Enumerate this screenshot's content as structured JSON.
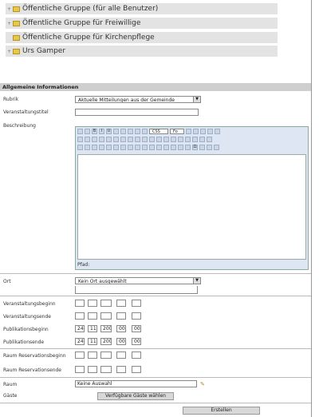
{
  "tree": {
    "items": [
      {
        "label": "Öffentliche Gruppe (für alle Benutzer)"
      },
      {
        "label": "Öffentliche Gruppe für Freiwillige"
      },
      {
        "label": "Öffentliche Gruppe für Kirchenpflege"
      },
      {
        "label": "Urs Gamper"
      }
    ]
  },
  "section": {
    "title": "Allgemeine Informationen"
  },
  "form": {
    "rubrik": {
      "label": "Rubrik",
      "value": "Aktuelle Mitteilungen aus der Gemeinde"
    },
    "titel": {
      "label": "Veranstaltungstitel",
      "value": ""
    },
    "beschreibung": {
      "label": "Beschreibung"
    },
    "editor": {
      "status": "Pfad:",
      "style_select": "CSS",
      "font_select": "Fo"
    },
    "ort": {
      "label": "Ort",
      "value": "Kein Ort ausgewählt"
    },
    "beginn": {
      "label": "Veranstaltungsbeginn"
    },
    "ende": {
      "label": "Veranstaltungsende"
    },
    "pub_beginn": {
      "label": "Publikationsbeginn",
      "d": "24",
      "m": "11",
      "y": "2008",
      "h": "00",
      "min": "00"
    },
    "pub_ende": {
      "label": "Publikationsende",
      "d": "24",
      "m": "11",
      "y": "2008",
      "h": "00",
      "min": "00"
    },
    "raum_beginn": {
      "label": "Raum Reservationsbeginn"
    },
    "raum_ende": {
      "label": "Raum Reservationsende"
    },
    "raum": {
      "label": "Raum",
      "value": "Keine Auswahl"
    },
    "gaeste": {
      "label": "Gäste",
      "button": "Verfügbare Gäste wählen"
    }
  },
  "footer": {
    "save_label": "Erstellen"
  }
}
